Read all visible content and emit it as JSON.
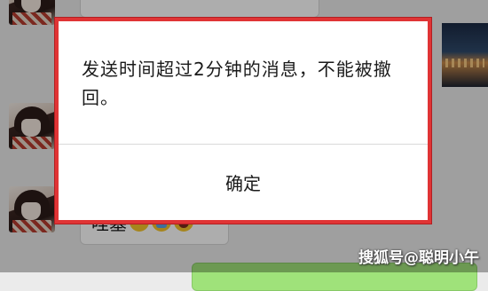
{
  "chat": {
    "received_message": "哇塞",
    "emojis": [
      "angry-face-emoji",
      "crying-face-emoji",
      "laughing-face-emoji"
    ]
  },
  "dialog": {
    "message": "发送时间超过2分钟的消息，不能被撤回。",
    "confirm_label": "确定"
  },
  "watermark": "搜狐号@聪明小午",
  "colors": {
    "dialog_border": "#e03435",
    "chat_background": "#ebebeb",
    "sent_bubble": "#9fe27a"
  }
}
